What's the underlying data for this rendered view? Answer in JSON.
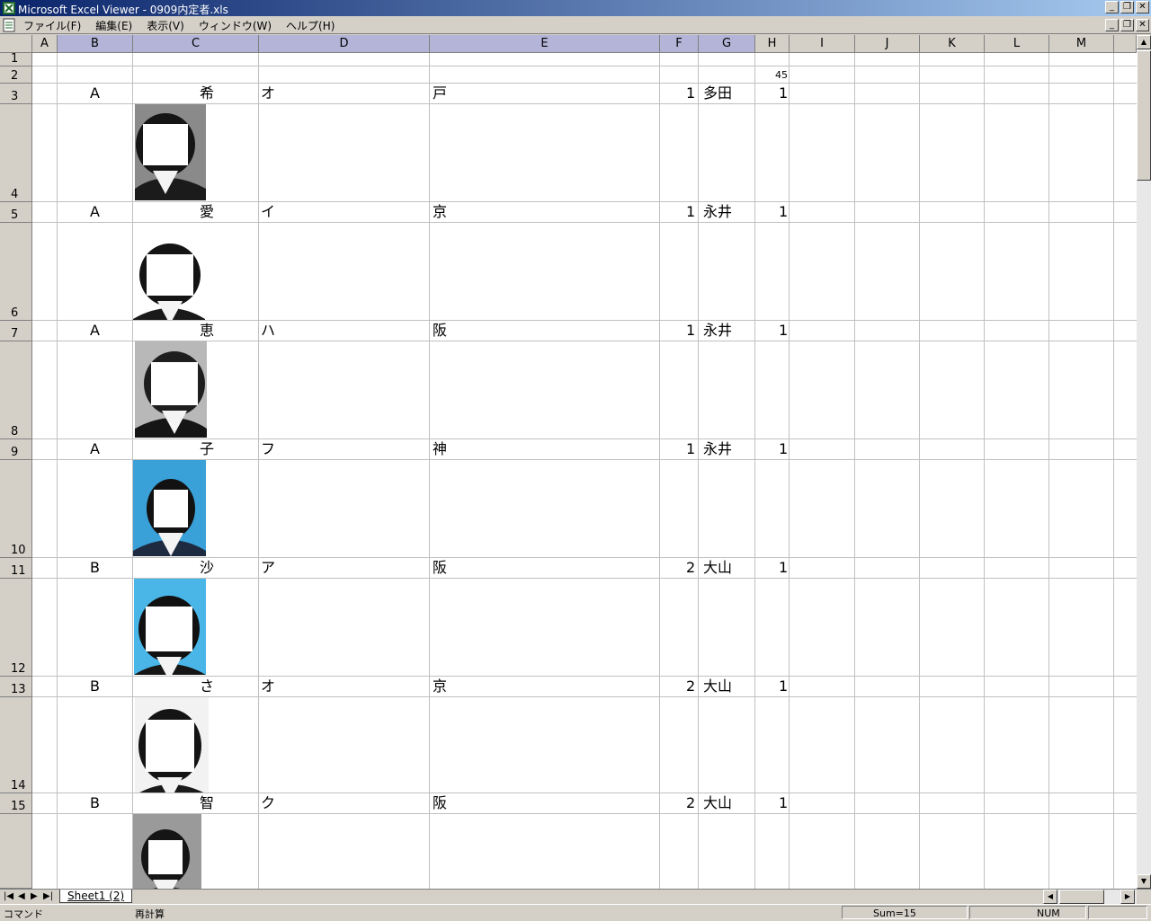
{
  "window": {
    "title": "Microsoft Excel Viewer - 0909内定者.xls"
  },
  "menu": [
    "ファイル(F)",
    "編集(E)",
    "表示(V)",
    "ウィンドウ(W)",
    "ヘルプ(H)"
  ],
  "columns": [
    "A",
    "B",
    "C",
    "D",
    "E",
    "F",
    "G",
    "H",
    "I",
    "J",
    "K",
    "L",
    "M"
  ],
  "rows": [
    "1",
    "2",
    "3",
    "4",
    "5",
    "6",
    "7",
    "8",
    "9",
    "10",
    "11",
    "12",
    "13",
    "14",
    "15"
  ],
  "cells": {
    "h2": "45",
    "records": [
      {
        "b": "A",
        "c": "希",
        "d": "オ",
        "e": "戸",
        "f": "1",
        "g": "多田",
        "h": "1"
      },
      {
        "b": "A",
        "c": "愛",
        "d": "イ",
        "e": "京",
        "f": "1",
        "g": "永井",
        "h": "1"
      },
      {
        "b": "A",
        "c": "恵",
        "d": "ハ",
        "e": "阪",
        "f": "1",
        "g": "永井",
        "h": "1"
      },
      {
        "b": "A",
        "c": "子",
        "d": "フ",
        "e": "神",
        "f": "1",
        "g": "永井",
        "h": "1"
      },
      {
        "b": "B",
        "c": "沙",
        "d": "ア",
        "e": "阪",
        "f": "2",
        "g": "大山",
        "h": "1"
      },
      {
        "b": "B",
        "c": "さ",
        "d": "オ",
        "e": "京",
        "f": "2",
        "g": "大山",
        "h": "1"
      },
      {
        "b": "B",
        "c": "智",
        "d": "ク",
        "e": "阪",
        "f": "2",
        "g": "大山",
        "h": "1"
      }
    ]
  },
  "photos": [
    {
      "bg": "#8a8a8a",
      "hair": "#151515",
      "suit": "#1b1b1b"
    },
    {
      "bg": "#ffffff",
      "hair": "#141414",
      "suit": "#1a1a1a"
    },
    {
      "bg": "#b8b8b8",
      "hair": "#1e1e1e",
      "suit": "#151515"
    },
    {
      "bg": "#3aa0d8",
      "hair": "#121212",
      "suit": "#1d2a40"
    },
    {
      "bg": "#4ab6e8",
      "hair": "#111111",
      "suit": "#161616"
    },
    {
      "bg": "#f2f2f2",
      "hair": "#141414",
      "suit": "#1a1a1a"
    },
    {
      "bg": "#9a9a9a",
      "hair": "#151515",
      "suit": "#202020"
    }
  ],
  "sheet_tab": "Sheet1 (2)",
  "status": {
    "mode": "コマンド",
    "recalc": "再計算",
    "sum": "Sum=15",
    "num": "NUM"
  }
}
